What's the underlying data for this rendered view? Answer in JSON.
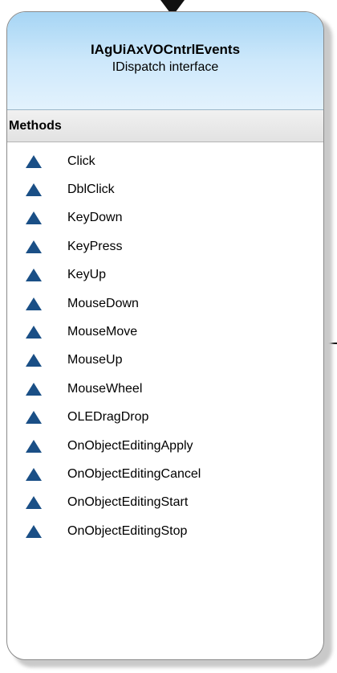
{
  "class_box": {
    "title": "IAgUiAxVOCntrlEvents",
    "subtitle": "IDispatch interface"
  },
  "section": {
    "label": "Methods"
  },
  "methods": [
    {
      "name": "Click",
      "icon": "method-triangle-icon"
    },
    {
      "name": "DblClick",
      "icon": "method-triangle-icon"
    },
    {
      "name": "KeyDown",
      "icon": "method-triangle-icon"
    },
    {
      "name": "KeyPress",
      "icon": "method-triangle-icon"
    },
    {
      "name": "KeyUp",
      "icon": "method-triangle-icon"
    },
    {
      "name": "MouseDown",
      "icon": "method-triangle-icon"
    },
    {
      "name": "MouseMove",
      "icon": "method-triangle-icon"
    },
    {
      "name": "MouseUp",
      "icon": "method-triangle-icon"
    },
    {
      "name": "MouseWheel",
      "icon": "method-triangle-icon"
    },
    {
      "name": "OLEDragDrop",
      "icon": "method-triangle-icon"
    },
    {
      "name": "OnObjectEditingApply",
      "icon": "method-triangle-icon"
    },
    {
      "name": "OnObjectEditingCancel",
      "icon": "method-triangle-icon"
    },
    {
      "name": "OnObjectEditingStart",
      "icon": "method-triangle-icon"
    },
    {
      "name": "OnObjectEditingStop",
      "icon": "method-triangle-icon"
    }
  ],
  "colors": {
    "header_gradient_top": "#a6d5f4",
    "header_gradient_bottom": "#e3f2fd",
    "method_icon": "#1a4f86",
    "border": "#8a8a8a"
  }
}
